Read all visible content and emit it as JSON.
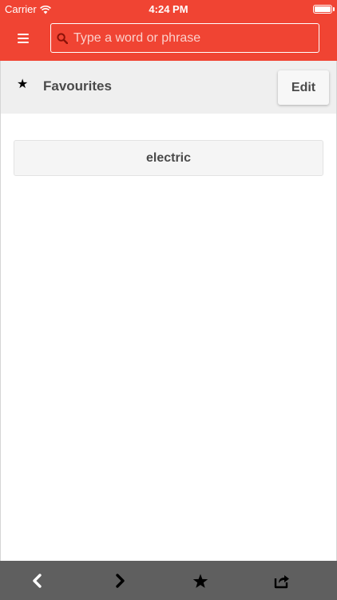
{
  "status_bar": {
    "carrier": "Carrier",
    "time": "4:24 PM"
  },
  "header": {
    "background_color": "#f04433",
    "menu_icon": "hamburger-menu-icon",
    "search": {
      "placeholder": "Type a word or phrase",
      "value": "",
      "icon": "search-icon"
    }
  },
  "favourites": {
    "icon": "star-icon",
    "title": "Favourites",
    "edit_label": "Edit",
    "items": [
      {
        "label": "electric"
      }
    ]
  },
  "toolbar": {
    "background_color": "#5f5f5f",
    "buttons": [
      {
        "icon": "chevron-left-icon"
      },
      {
        "icon": "chevron-right-icon"
      },
      {
        "icon": "star-icon"
      },
      {
        "icon": "share-icon"
      }
    ]
  }
}
